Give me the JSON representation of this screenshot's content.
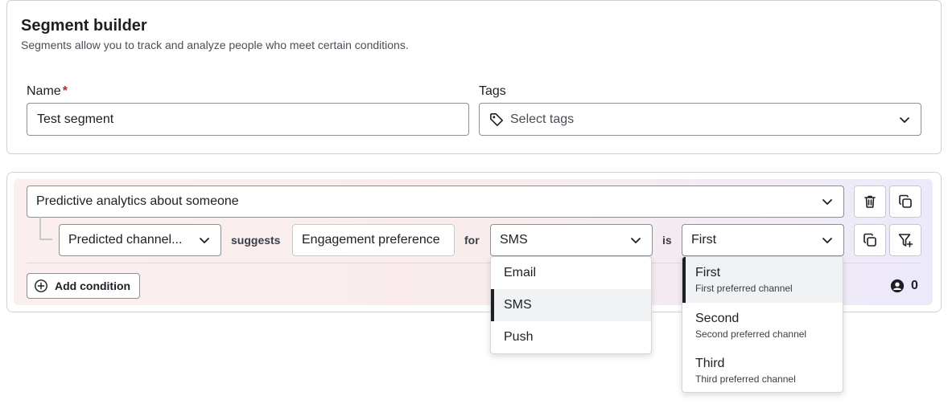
{
  "header": {
    "title": "Segment builder",
    "subtitle": "Segments allow you to track and analyze people who meet certain conditions."
  },
  "form": {
    "name_label": "Name",
    "required_mark": "*",
    "name_value": "Test segment",
    "tags_label": "Tags",
    "tags_placeholder": "Select tags"
  },
  "condition": {
    "category": "Predictive analytics about someone",
    "attribute": "Predicted channel...",
    "op_word": "suggests",
    "metric": "Engagement preference",
    "for_word": "for",
    "channel": "SMS",
    "is_word": "is",
    "rank": "First"
  },
  "channel_menu": {
    "options": [
      "Email",
      "SMS",
      "Push"
    ],
    "selected": "SMS"
  },
  "rank_menu": {
    "options": [
      {
        "title": "First",
        "desc": "First preferred channel"
      },
      {
        "title": "Second",
        "desc": "Second preferred channel"
      },
      {
        "title": "Third",
        "desc": "Third preferred channel"
      }
    ],
    "selected": "First"
  },
  "footer": {
    "add_condition": "Add condition",
    "people_count": "0"
  },
  "icons": [
    "tag-icon",
    "chevron-down-icon",
    "trash-icon",
    "duplicate-icon",
    "filter-add-icon",
    "plus-circle-icon",
    "person-icon"
  ],
  "colors": {
    "required": "#c4262e",
    "selection_bar": "#1c1f23",
    "panel_tint_start": "#fbeeee",
    "panel_tint_end": "#ece9fb"
  }
}
